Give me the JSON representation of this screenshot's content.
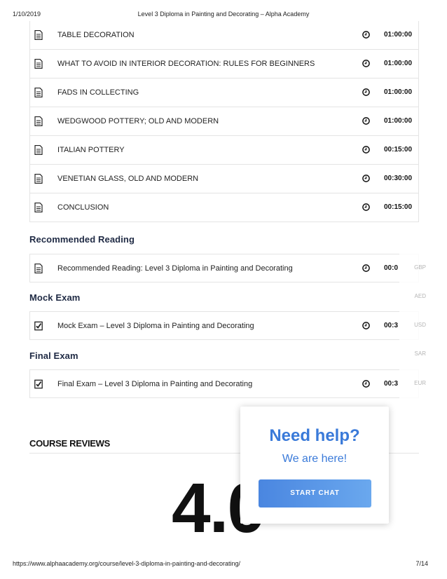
{
  "print_header": {
    "date": "1/10/2019",
    "title": "Level 3 Diploma in Painting and Decorating – Alpha Academy"
  },
  "print_footer": {
    "url": "https://www.alphaacademy.org/course/level-3-diploma-in-painting-and-decorating/",
    "page": "7/14"
  },
  "lessons": [
    {
      "icon": "document-icon",
      "label": "TABLE DECORATION",
      "duration": "01:00:00"
    },
    {
      "icon": "document-icon",
      "label": "WHAT TO AVOID IN INTERIOR DECORATION: RULES FOR BEGINNERS",
      "duration": "01:00:00"
    },
    {
      "icon": "document-icon",
      "label": "FADS IN COLLECTING",
      "duration": "01:00:00"
    },
    {
      "icon": "document-icon",
      "label": "WEDGWOOD POTTERY; OLD AND MODERN",
      "duration": "01:00:00"
    },
    {
      "icon": "document-icon",
      "label": "ITALIAN POTTERY",
      "duration": "00:15:00"
    },
    {
      "icon": "document-icon",
      "label": "VENETIAN GLASS, OLD AND MODERN",
      "duration": "00:30:00"
    },
    {
      "icon": "document-icon",
      "label": "CONCLUSION",
      "duration": "00:15:00"
    }
  ],
  "sections": [
    {
      "title": "Recommended Reading",
      "items": [
        {
          "icon": "document-icon",
          "label": "Recommended Reading: Level 3 Diploma in Painting and Decorating",
          "duration": "00:0"
        }
      ]
    },
    {
      "title": "Mock Exam",
      "items": [
        {
          "icon": "quiz-check-icon",
          "label": "Mock Exam – Level 3 Diploma in Painting and Decorating",
          "duration": "00:3"
        }
      ]
    },
    {
      "title": "Final Exam",
      "items": [
        {
          "icon": "quiz-check-icon",
          "label": "Final Exam – Level 3 Diploma in Painting and Decorating",
          "duration": "00:3"
        }
      ]
    }
  ],
  "currencies": [
    "GBP",
    "AED",
    "USD",
    "SAR",
    "EUR"
  ],
  "reviews": {
    "title": "COURSE REVIEWS",
    "rating": "4.0"
  },
  "help_widget": {
    "heading": "Need help?",
    "subheading": "We are here!",
    "button_label": "START CHAT"
  },
  "colors": {
    "accent": "#3a7ad9",
    "button_start": "#4a86e0",
    "button_end": "#6aa8ee",
    "border": "#e4e4e4"
  }
}
